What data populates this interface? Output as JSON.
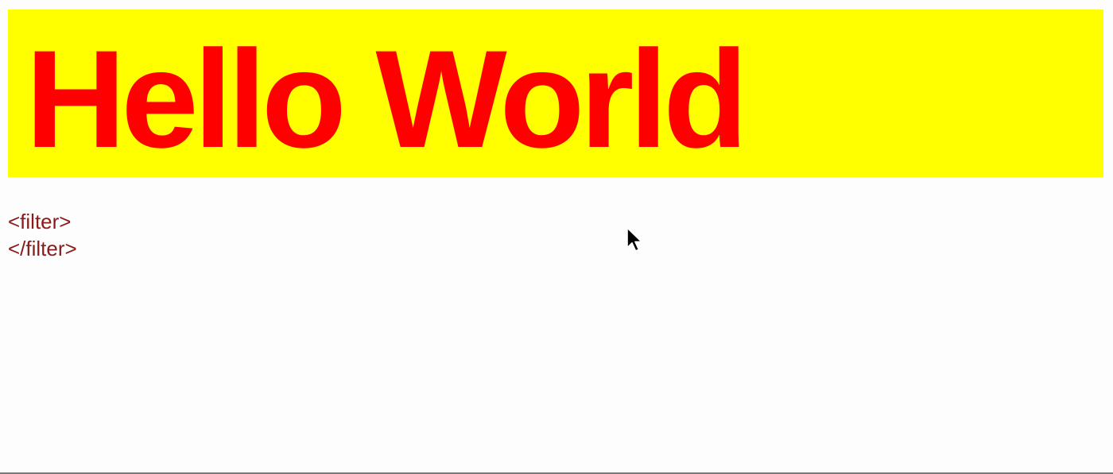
{
  "banner": {
    "heading": "Hello World",
    "background_color": "#ffff00",
    "text_color": "#ff0000"
  },
  "code": {
    "open_tag": "<filter>",
    "close_tag": "</filter>",
    "text_color": "#8b1a1a"
  },
  "cursor": {
    "icon": "mouse-pointer-icon"
  }
}
